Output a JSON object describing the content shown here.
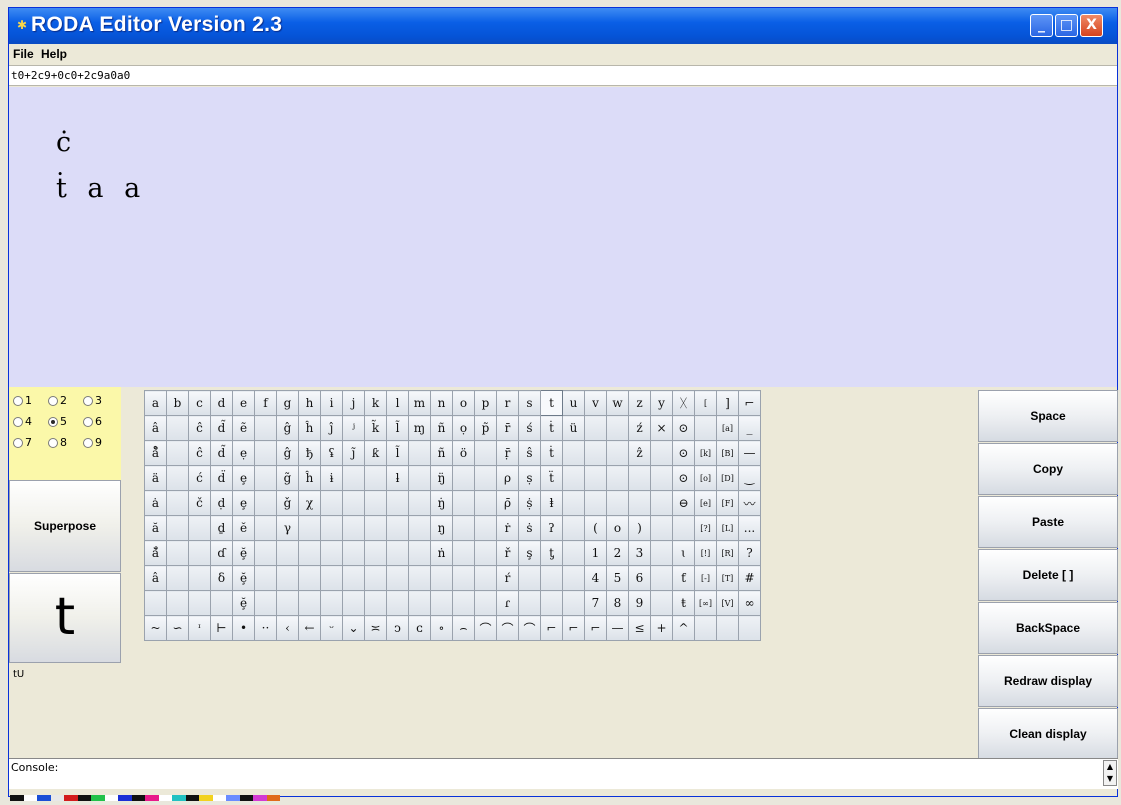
{
  "window": {
    "title": "RODA Editor  Version 2.3",
    "min": "_",
    "max": "□",
    "close": "X"
  },
  "menu": [
    "File",
    "Help"
  ],
  "address": "t0+2c9+0c0+2c9a0a0",
  "display": {
    "line1": "ċ",
    "line2": "ṫ a a"
  },
  "radios": [
    [
      {
        "label": "1",
        "checked": false
      },
      {
        "label": "2",
        "checked": false
      },
      {
        "label": "3",
        "checked": false
      }
    ],
    [
      {
        "label": "4",
        "checked": false
      },
      {
        "label": "5",
        "checked": true
      },
      {
        "label": "6",
        "checked": false
      }
    ],
    [
      {
        "label": "7",
        "checked": false
      },
      {
        "label": "8",
        "checked": false
      },
      {
        "label": "9",
        "checked": false
      }
    ]
  ],
  "left_buttons": {
    "superpose": "Superpose",
    "glyph": "t"
  },
  "status_left": "tU",
  "grid": [
    [
      "a",
      "b",
      "c",
      "d",
      "e",
      "f",
      "g",
      "h",
      "i",
      "j",
      "k",
      "l",
      "m",
      "n",
      "o",
      "p",
      "r",
      "s",
      "t",
      "u",
      "v",
      "w",
      "z",
      "y",
      "ᚷ",
      "[",
      "]",
      "⌐"
    ],
    [
      "â",
      "",
      "ĉ",
      "d̃",
      "ẽ",
      "",
      "ĝ",
      "ĥ",
      "ĵ",
      "ʲ",
      "k̃",
      "l̃",
      "ɱ",
      "ñ",
      "ọ",
      "p̃",
      "r̄",
      "ś",
      "ṫ",
      "ü",
      "",
      "",
      "ź",
      "×",
      "⊙",
      "",
      "[a]",
      "_"
    ],
    [
      "å̊",
      "",
      "ĉ",
      "d̃",
      "ẹ",
      "",
      "ĝ",
      "ђ",
      "ʢ",
      "j̃",
      "ƙ",
      "l̃",
      "",
      "ñ",
      "ö",
      "",
      "ṝ",
      "ŝ",
      "ṫ",
      "",
      "",
      "",
      "ẑ",
      "",
      "⊙",
      "[k]",
      "[B]",
      "—"
    ],
    [
      "ä",
      "",
      "ć",
      "d̈",
      "ȩ",
      "",
      "g̃",
      "ĥ",
      "ɨ",
      "",
      "",
      "ƚ",
      "",
      "ŋ̈",
      "",
      "",
      "ρ",
      "ṣ",
      "ẗ",
      "",
      "",
      "",
      "",
      "",
      "⊙",
      "[o]",
      "[D]",
      "‿"
    ],
    [
      "ȧ",
      "",
      "č",
      "ḍ",
      "ȩ",
      "",
      "ǧ",
      "χ",
      "",
      "",
      "",
      "",
      "",
      "ŋ̇",
      "",
      "",
      "ρ̄",
      "ṩ",
      "ⱡ",
      "",
      "",
      "",
      "",
      "",
      "⊖",
      "[e]",
      "[F]",
      "〰"
    ],
    [
      "ă",
      "",
      "",
      "ḏ",
      "ĕ",
      "",
      "γ",
      "",
      "",
      "",
      "",
      "",
      "",
      "ŋ",
      "",
      "",
      "ṙ",
      "ṡ",
      "ʔ",
      "",
      "(",
      "o",
      ")",
      "",
      "",
      "[?]",
      "[L]",
      "..."
    ],
    [
      "ă̊",
      "",
      "",
      "ɗ",
      "ḝ",
      "",
      "",
      "",
      "",
      "",
      "",
      "",
      "",
      "ṅ",
      "",
      "",
      "ř",
      "ş",
      "ƫ",
      "",
      "1",
      "2",
      "3",
      "",
      "ɩ",
      "[!]",
      "[R]",
      "?"
    ],
    [
      "â",
      "",
      "",
      "δ",
      "ḝ",
      "",
      "",
      "",
      "",
      "",
      "",
      "",
      "",
      "",
      "",
      "",
      "ŕ",
      "",
      "",
      "",
      "4",
      "5",
      "6",
      "",
      "ƭ",
      "[-]",
      "[T]",
      "#"
    ],
    [
      "",
      "",
      "",
      "",
      "ḝ",
      "",
      "",
      "",
      "",
      "",
      "",
      "",
      "",
      "",
      "",
      "",
      "ɾ",
      "",
      "",
      "",
      "7",
      "8",
      "9",
      "",
      "ŧ",
      "[∞]",
      "[V]",
      "∞"
    ],
    [
      "~",
      "∽",
      "ᶦ",
      "⊢",
      "•",
      "··",
      "‹",
      "←",
      "ᵕ",
      "⌄",
      "≍",
      "ↄ",
      "ᴄ",
      "∘",
      "⌢",
      "⌒",
      "⌒",
      "⌒",
      "⌐",
      "⌐",
      "⌐",
      "—",
      "≤",
      "+",
      "^",
      "",
      "",
      ""
    ]
  ],
  "right_buttons": [
    "Space",
    "Copy",
    "Paste",
    "Delete [ ]",
    "BackSpace",
    "Redraw display",
    "Clean display"
  ],
  "console_label": "Console:",
  "palette": [
    "#111111",
    "#ffffff",
    "#1a4fd6",
    "#e8e8e8",
    "#d31c1c",
    "#111111",
    "#21c24a",
    "#ffffff",
    "#1a2fd6",
    "#111111",
    "#e8198a",
    "#ffffff",
    "#21c2c2",
    "#111111",
    "#f2d21e",
    "#ffffff",
    "#6a8cff",
    "#111111",
    "#d33ad3",
    "#e06a1a"
  ]
}
